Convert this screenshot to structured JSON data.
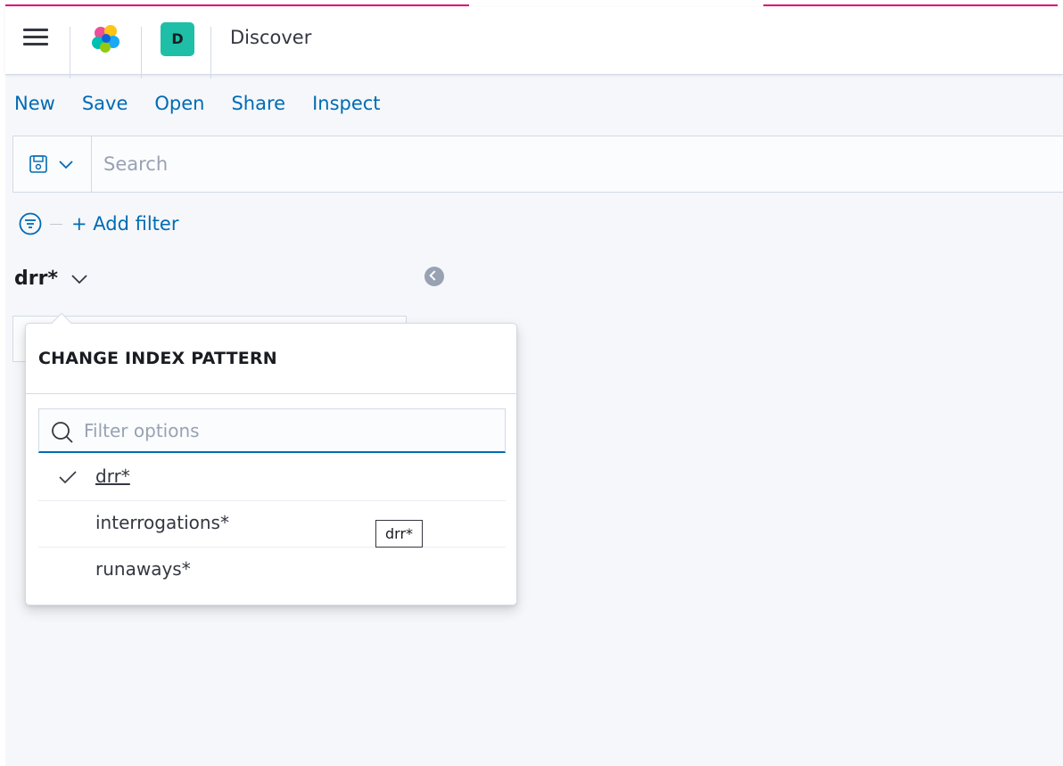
{
  "header": {
    "space_initial": "D",
    "app_title": "Discover"
  },
  "topnav": [
    {
      "label": "New"
    },
    {
      "label": "Save"
    },
    {
      "label": "Open"
    },
    {
      "label": "Share"
    },
    {
      "label": "Inspect"
    }
  ],
  "query": {
    "placeholder": "Search",
    "value": ""
  },
  "filters": {
    "add_filter_label": "+ Add filter"
  },
  "index_pattern": {
    "current": "drr*"
  },
  "popover": {
    "title": "CHANGE INDEX PATTERN",
    "filter_placeholder": "Filter options",
    "options": [
      {
        "label": "drr*",
        "selected": true
      },
      {
        "label": "interrogations*",
        "selected": false
      },
      {
        "label": "runaways*",
        "selected": false
      }
    ]
  },
  "tooltip": {
    "text": "drr*"
  },
  "colors": {
    "link": "#006bb4",
    "accent_bar": "#dd0a73",
    "space_avatar": "#1ebfa6"
  },
  "icons": {
    "menu": "hamburger-menu-icon",
    "logo": "kibana-logo-icon",
    "saved_query": "save-icon",
    "filter": "filter-icon",
    "search": "search-icon",
    "check": "check-icon",
    "collapse": "collapse-arrow-icon",
    "chevron": "chevron-down-icon"
  }
}
